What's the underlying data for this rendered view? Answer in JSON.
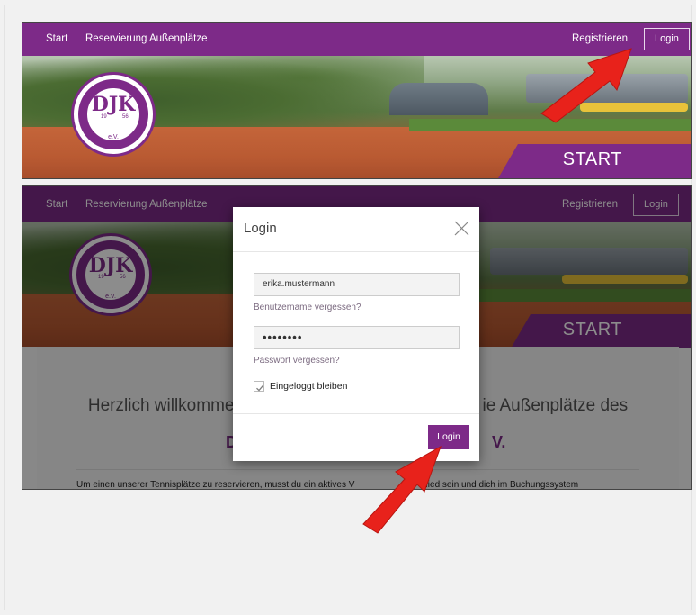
{
  "nav": {
    "start": "Start",
    "reservation": "Reservierung Außenplätze",
    "register": "Registrieren",
    "login": "Login"
  },
  "banner": {
    "start_label": "START",
    "logo_text": "DJK",
    "logo_year_left": "19",
    "logo_year_right": "56",
    "logo_ev": "e.V."
  },
  "page": {
    "welcome_left": "Herzlich willkomme",
    "welcome_right": "ie Außenplätze des",
    "org_left": "D",
    "org_right": "V.",
    "intro_left": "Um einen unserer Tennisplätze zu reservieren, musst du ein aktives V",
    "intro_right": "glied sein und dich im Buchungssystem"
  },
  "modal": {
    "title": "Login",
    "username_value": "erika.mustermann",
    "forgot_username": "Benutzername vergessen?",
    "password_value": "••••••••",
    "forgot_password": "Passwort vergessen?",
    "remember_me": "Eingeloggt bleiben",
    "remember_checked": true,
    "submit": "Login"
  },
  "colors": {
    "brand": "#7d2a88",
    "arrow": "#e8221b"
  }
}
